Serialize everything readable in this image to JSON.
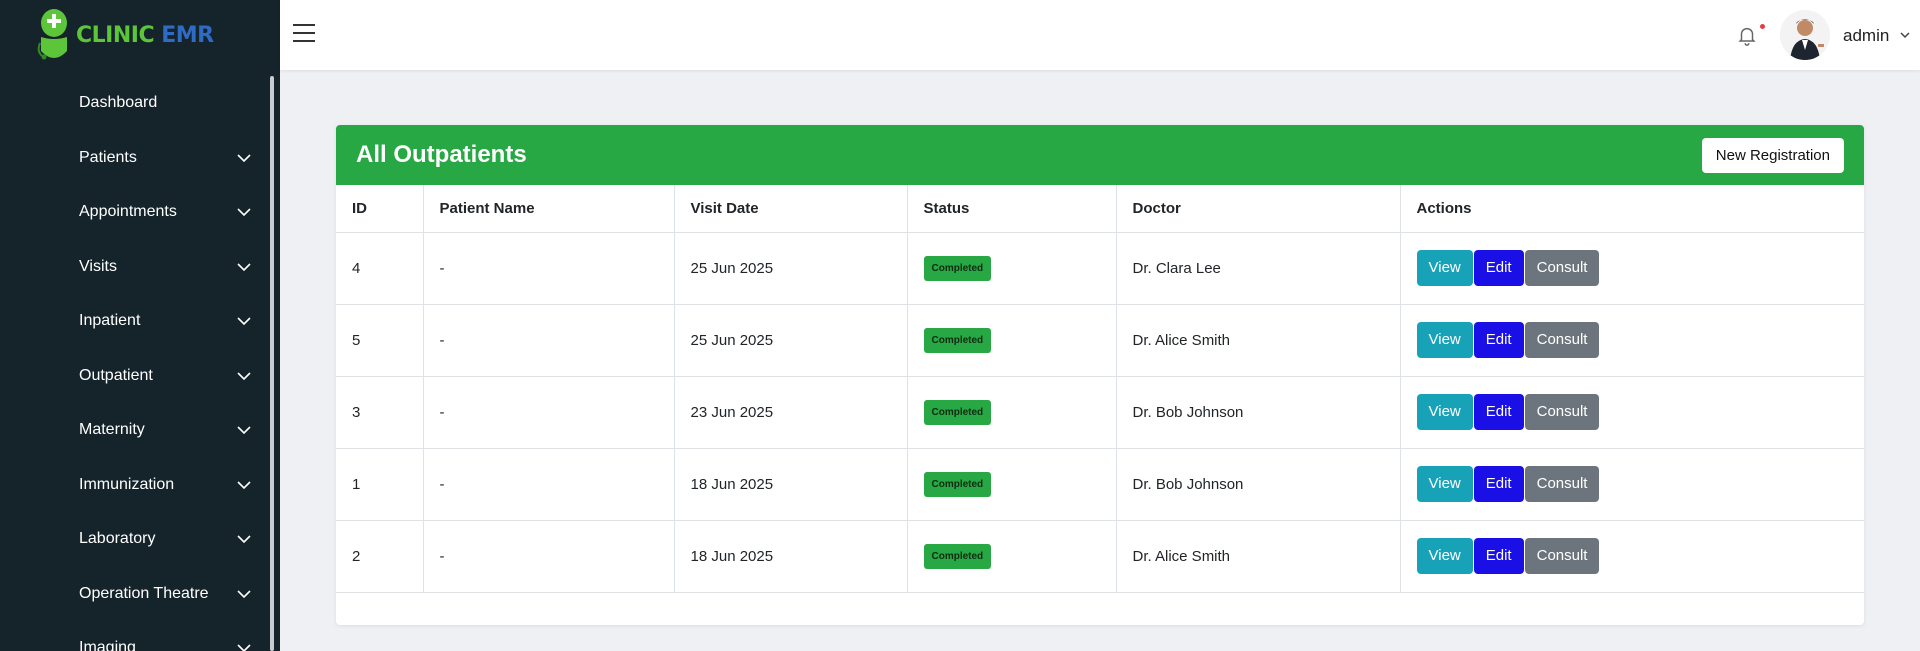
{
  "brand": {
    "part1": "CLINIC",
    "part2": "EMR"
  },
  "colors": {
    "sidebar_bg": "#15232b",
    "header_green": "#28a745",
    "view": "#17a2b8",
    "edit": "#1a10e6",
    "consult": "#6c757d"
  },
  "sidebar": {
    "items": [
      {
        "label": "Dashboard",
        "expandable": false
      },
      {
        "label": "Patients",
        "expandable": true
      },
      {
        "label": "Appointments",
        "expandable": true
      },
      {
        "label": "Visits",
        "expandable": true
      },
      {
        "label": "Inpatient",
        "expandable": true
      },
      {
        "label": "Outpatient",
        "expandable": true
      },
      {
        "label": "Maternity",
        "expandable": true
      },
      {
        "label": "Immunization",
        "expandable": true
      },
      {
        "label": "Laboratory",
        "expandable": true
      },
      {
        "label": "Operation Theatre",
        "expandable": true
      },
      {
        "label": "Imaging",
        "expandable": true
      }
    ]
  },
  "header": {
    "user_name": "admin",
    "icons": [
      "menu-icon",
      "bell-icon",
      "avatar",
      "chevron-down-icon"
    ]
  },
  "main": {
    "title": "All Outpatients",
    "new_button": "New Registration",
    "columns": [
      "ID",
      "Patient Name",
      "Visit Date",
      "Status",
      "Doctor",
      "Actions"
    ],
    "rows": [
      {
        "id": "4",
        "patient": "-",
        "date": "25 Jun 2025",
        "status": "Completed",
        "doctor": "Dr. Clara Lee"
      },
      {
        "id": "5",
        "patient": "-",
        "date": "25 Jun 2025",
        "status": "Completed",
        "doctor": "Dr. Alice Smith"
      },
      {
        "id": "3",
        "patient": "-",
        "date": "23 Jun 2025",
        "status": "Completed",
        "doctor": "Dr. Bob Johnson"
      },
      {
        "id": "1",
        "patient": "-",
        "date": "18 Jun 2025",
        "status": "Completed",
        "doctor": "Dr. Bob Johnson"
      },
      {
        "id": "2",
        "patient": "-",
        "date": "18 Jun 2025",
        "status": "Completed",
        "doctor": "Dr. Alice Smith"
      }
    ],
    "actions": {
      "view": "View",
      "edit": "Edit",
      "consult": "Consult"
    }
  }
}
